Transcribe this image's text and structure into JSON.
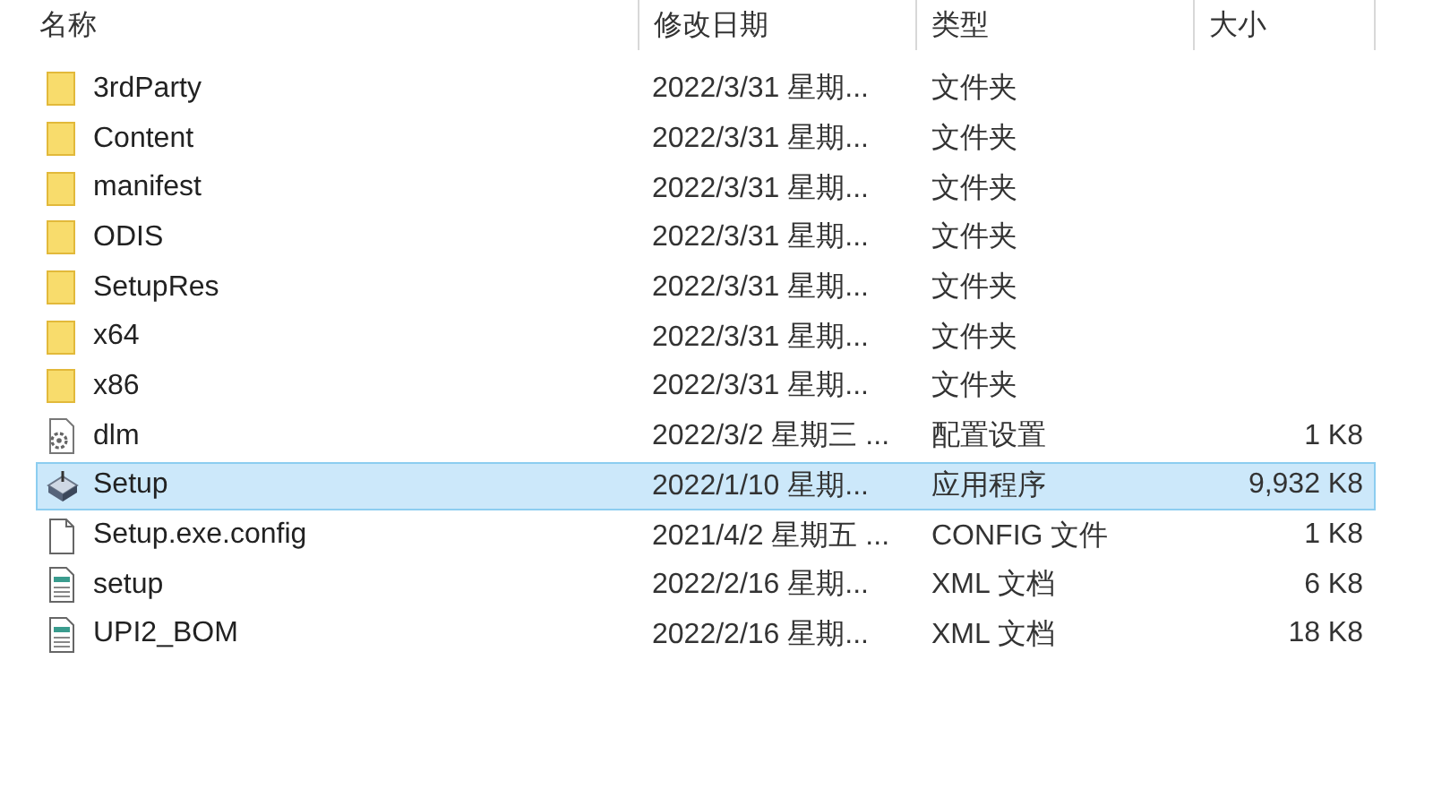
{
  "columns": [
    {
      "label": "名称"
    },
    {
      "label": "修改日期"
    },
    {
      "label": "类型"
    },
    {
      "label": "大小"
    }
  ],
  "rows": [
    {
      "kind": "folder",
      "name": "3rdParty",
      "date": "2022/3/31 星期...",
      "type": "文件夹",
      "selected": false
    },
    {
      "kind": "folder",
      "name": "Content",
      "date": "2022/3/31 星期...",
      "type": "文件夹",
      "selected": false
    },
    {
      "kind": "folder",
      "name": "manifest",
      "date": "2022/3/31 星期...",
      "type": "文件夹",
      "selected": false
    },
    {
      "kind": "folder",
      "name": "ODIS",
      "date": "2022/3/31 星期...",
      "type": "文件夹",
      "selected": false
    },
    {
      "kind": "folder",
      "name": "SetupRes",
      "date": "2022/3/31 星期...",
      "type": "文件夹",
      "selected": false
    },
    {
      "kind": "folder",
      "name": "x64",
      "date": "2022/3/31 星期...",
      "type": "文件夹",
      "selected": false
    },
    {
      "kind": "folder",
      "name": "x86",
      "date": "2022/3/31 星期...",
      "type": "文件夹",
      "selected": false
    },
    {
      "kind": "settings",
      "name": "dlm",
      "date": "2022/3/2 星期三 ...",
      "type": "配置设置",
      "size": "1 K8",
      "selected": false
    },
    {
      "kind": "app",
      "name": "Setup",
      "date": "2022/1/10 星期...",
      "type": "应用程序",
      "size": "9,932 K8",
      "selected": true
    },
    {
      "kind": "file",
      "name": "Setup.exe.config",
      "date": "2021/4/2 星期五 ...",
      "type": "CONFIG 文件",
      "size": "1 K8",
      "selected": false
    },
    {
      "kind": "xml",
      "name": "setup",
      "date": "2022/2/16 星期...",
      "type": "XML 文档",
      "size": "6 K8",
      "selected": false
    },
    {
      "kind": "xml",
      "name": "UPI2_BOM",
      "date": "2022/2/16 星期...",
      "type": "XML 文档",
      "size": "18 K8",
      "selected": false
    }
  ]
}
